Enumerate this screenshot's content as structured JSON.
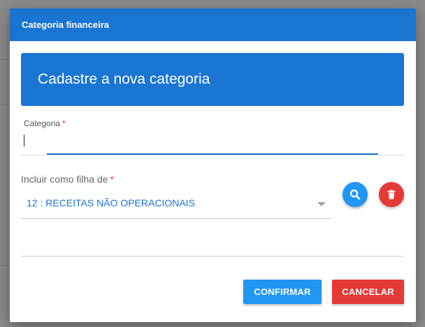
{
  "dialog": {
    "title": "Categoria financeira",
    "banner_text": "Cadastre a nova categoria"
  },
  "form": {
    "category_field": {
      "label": "Categoria",
      "required_mark": "*",
      "value": ""
    },
    "parent_field": {
      "label": "Incluir como filha de",
      "required_mark": "*",
      "selected_value": "12 : RECEITAS NÃO OPERACIONAIS"
    }
  },
  "actions": {
    "confirm_label": "CONFIRMAR",
    "cancel_label": "CANCELAR"
  },
  "icons": {
    "search": "search-icon",
    "delete": "trash-icon",
    "dropdown": "chevron-down-icon"
  },
  "colors": {
    "primary": "#1a74d2",
    "accent_blue": "#2196f3",
    "danger": "#e53935"
  }
}
